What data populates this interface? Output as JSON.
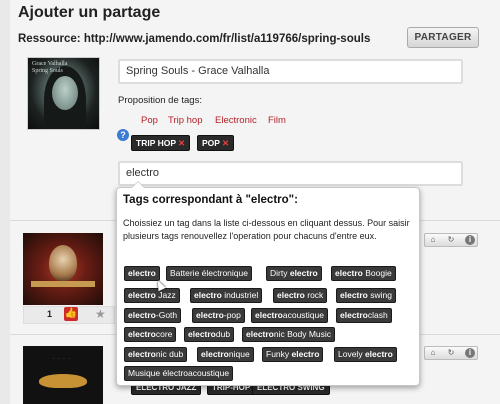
{
  "page": {
    "title": "Ajouter un partage",
    "resource": "Ressource: http://www.jamendo.com/fr/list/a119766/spring-souls",
    "share_button": "PARTAGER"
  },
  "cover": {
    "line1": "Grace Valhalla",
    "line2": "Spring Souls"
  },
  "title_input": {
    "value": "Spring Souls - Grace Valhalla"
  },
  "tags": {
    "label": "Proposition de tags:",
    "suggestions": [
      "Pop",
      "Trip hop",
      "Electronic",
      "Film"
    ],
    "help": "?",
    "selected": [
      {
        "label": "TRIP HOP",
        "remove": "✕"
      },
      {
        "label": "POP",
        "remove": "✕"
      }
    ]
  },
  "search_input": {
    "value": "electro"
  },
  "dropdown": {
    "heading": "Tags correspondant à \"electro\":",
    "instructions": "Choissiez un tag dans la liste ci-dessous en cliquant dessus. Pour saisir plusieurs tags renouvellez l'operation pour chacuns d'entre eux.",
    "options": [
      {
        "pre": "",
        "match": "electro",
        "post": ""
      },
      {
        "pre": "Batterie électronique",
        "match": "",
        "post": ""
      },
      {
        "pre": "Dirty ",
        "match": "electro",
        "post": ""
      },
      {
        "pre": "",
        "match": "electro",
        "post": " Boogie"
      },
      {
        "pre": "",
        "match": "electro",
        "post": " Jazz"
      },
      {
        "pre": "",
        "match": "electro",
        "post": " industriel"
      },
      {
        "pre": "",
        "match": "electro",
        "post": " rock"
      },
      {
        "pre": "",
        "match": "electro",
        "post": " swing"
      },
      {
        "pre": "",
        "match": "electro",
        "post": "-Goth"
      },
      {
        "pre": "",
        "match": "electro",
        "post": "-pop"
      },
      {
        "pre": "",
        "match": "electro",
        "post": "acoustique"
      },
      {
        "pre": "",
        "match": "electro",
        "post": "clash"
      },
      {
        "pre": "",
        "match": "electro",
        "post": "core"
      },
      {
        "pre": "",
        "match": "electro",
        "post": "dub"
      },
      {
        "pre": "",
        "match": "electro",
        "post": "nic Body Music"
      },
      {
        "pre": "",
        "match": "electro",
        "post": "nic dub"
      },
      {
        "pre": "",
        "match": "electro",
        "post": "nique"
      },
      {
        "pre": "Funky ",
        "match": "electro",
        "post": ""
      },
      {
        "pre": "Lovely ",
        "match": "electro",
        "post": ""
      },
      {
        "pre": "Musique électroacoustique",
        "match": "",
        "post": ""
      }
    ]
  },
  "rows": {
    "row1": {
      "votes": "1",
      "thumb": "👍",
      "star": "★"
    },
    "bottom_chips": [
      "ELECTRO JAZZ",
      "TRIP-HOP",
      "ELECTRO SWING"
    ]
  },
  "icons": {
    "tag": "⌂",
    "refresh": "↻",
    "info": "i"
  },
  "colors": {
    "tag_suggestion": "#b3222a",
    "chip_bg": "#2a2a2a",
    "remove_x": "#e84040"
  }
}
